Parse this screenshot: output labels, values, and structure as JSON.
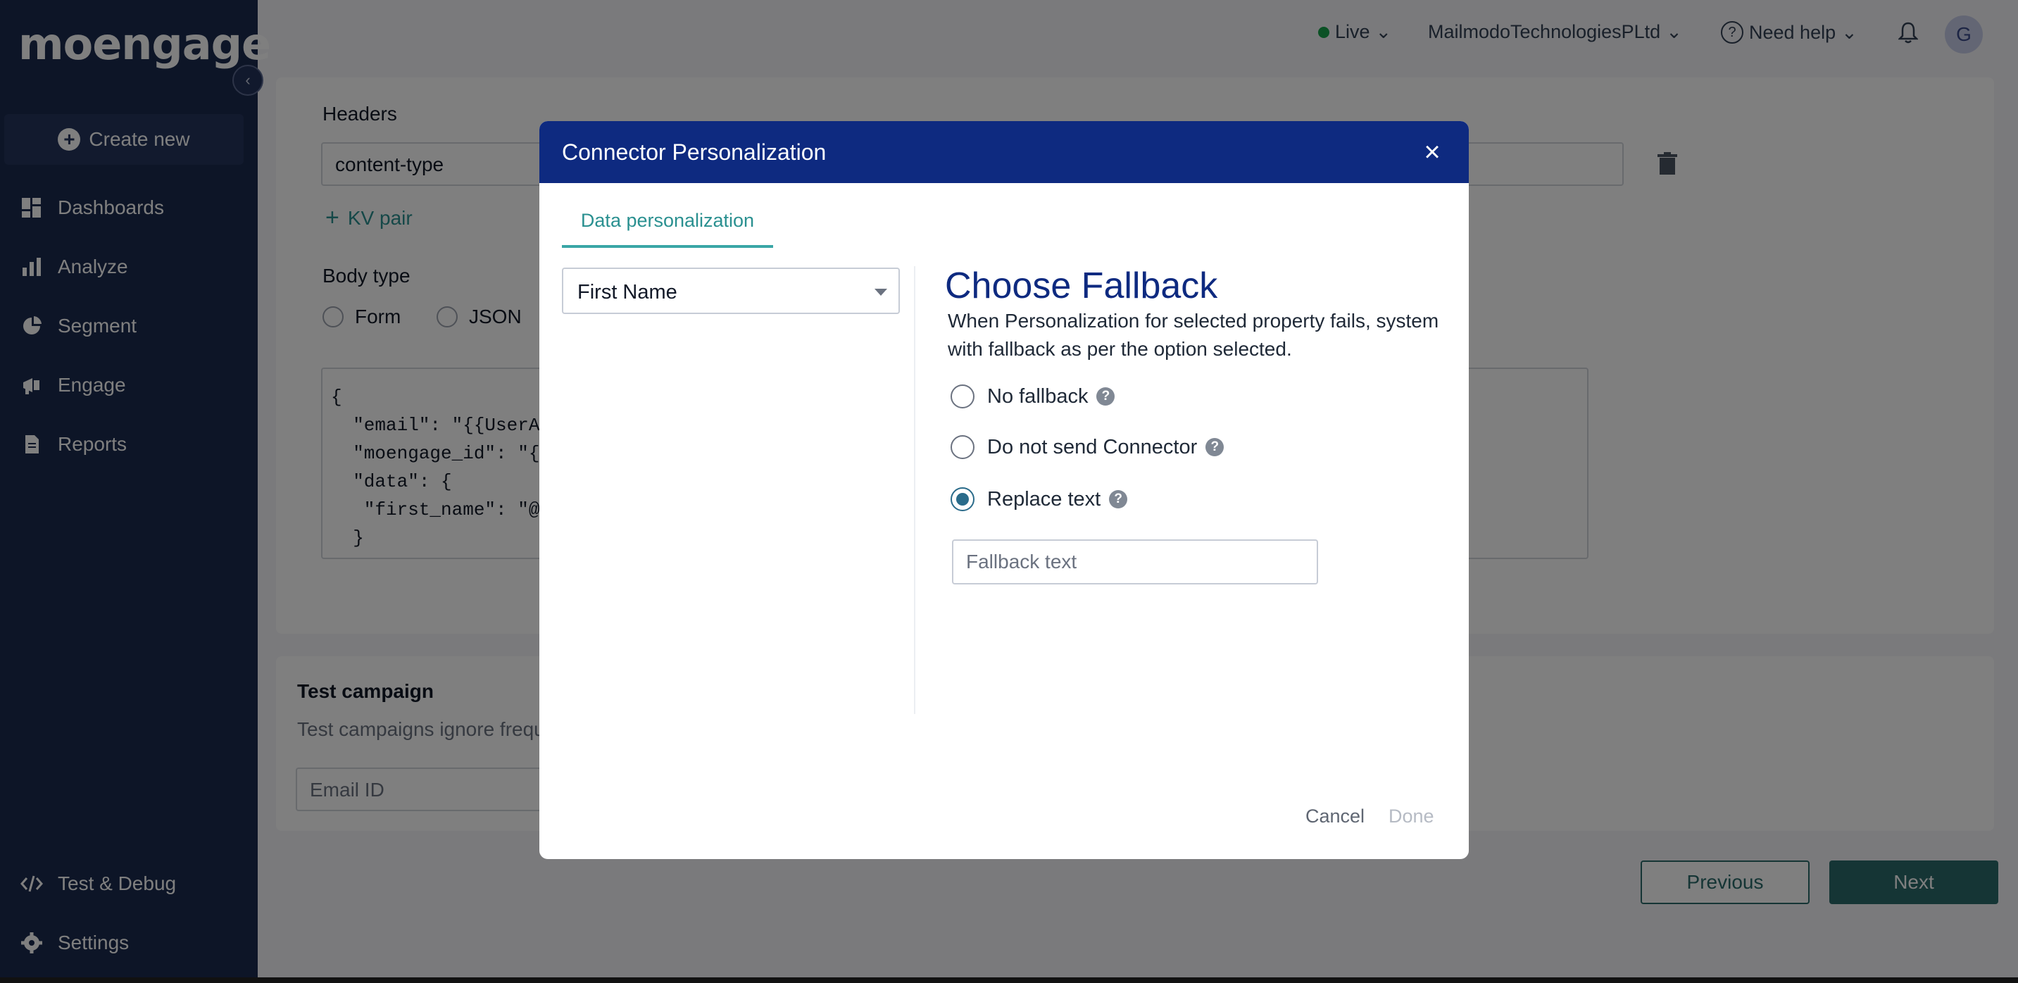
{
  "app": {
    "logo_text": "moengage"
  },
  "sidebar": {
    "create_new_label": "Create new",
    "items": [
      {
        "label": "Dashboards",
        "icon": "dashboard-icon"
      },
      {
        "label": "Analyze",
        "icon": "bar-chart-icon"
      },
      {
        "label": "Segment",
        "icon": "pie-chart-icon"
      },
      {
        "label": "Engage",
        "icon": "megaphone-icon"
      },
      {
        "label": "Reports",
        "icon": "document-icon"
      }
    ],
    "bottom_items": [
      {
        "label": "Test & Debug",
        "icon": "code-icon"
      },
      {
        "label": "Settings",
        "icon": "gear-icon"
      }
    ]
  },
  "topbar": {
    "env_label": "Live",
    "workspace_label": "MailmodoTechnologiesPLtd",
    "help_label": "Need help",
    "avatar_initial": "G"
  },
  "background": {
    "headers_label": "Headers",
    "header_key_value": "content-type",
    "kv_pair_label": "KV pair",
    "body_type_label": "Body type",
    "body_type_options": [
      "Form",
      "JSON"
    ],
    "code_lines": [
      "{",
      "  \"email\": \"{{UserAttribut",
      "  \"moengage_id\": \"{{Use",
      "  \"data\": {",
      "   \"first_name\": \"@\"",
      "  }"
    ],
    "test_campaign_title": "Test campaign",
    "test_campaign_desc": "Test campaigns ignore frequ",
    "email_id_label": "Email ID",
    "previous_label": "Previous",
    "next_label": "Next"
  },
  "modal": {
    "title": "Connector Personalization",
    "tab_label": "Data personalization",
    "selected_attribute": "First Name",
    "fallback_title": "Choose Fallback",
    "fallback_description": "When Personalization for selected property fails, system with fallback as per the option selected.",
    "options": [
      {
        "label": "No fallback",
        "checked": false
      },
      {
        "label": "Do not send Connector",
        "checked": false
      },
      {
        "label": "Replace text",
        "checked": true
      }
    ],
    "fallback_placeholder": "Fallback text",
    "cancel_label": "Cancel",
    "done_label": "Done"
  },
  "colors": {
    "sidebar_bg": "#1b2a4e",
    "modal_header_bg": "#0e2a80",
    "accent_teal": "#2a9090",
    "primary_button": "#2a6b6b"
  }
}
